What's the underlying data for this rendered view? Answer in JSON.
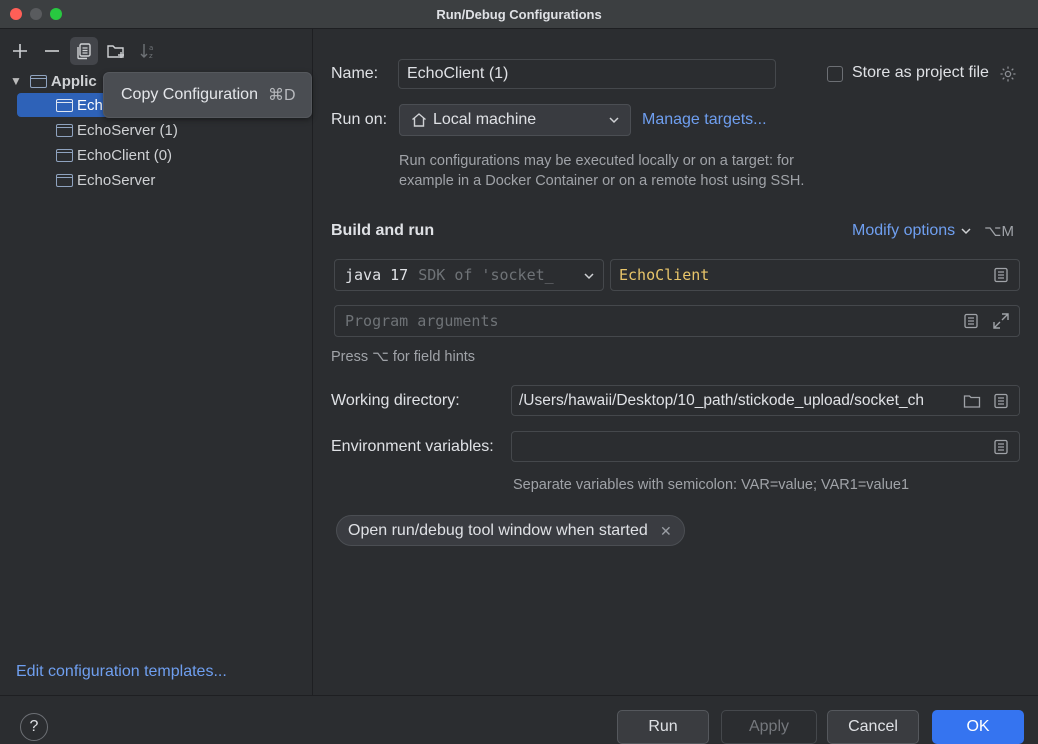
{
  "window": {
    "title": "Run/Debug Configurations"
  },
  "sidebar": {
    "tooltip": {
      "label": "Copy Configuration",
      "shortcut": "⌘D"
    },
    "tree": {
      "group_label": "Applic",
      "items": [
        {
          "label": "Echo",
          "selected": true
        },
        {
          "label": "EchoServer (1)"
        },
        {
          "label": "EchoClient (0)"
        },
        {
          "label": "EchoServer"
        }
      ]
    },
    "edit_templates": "Edit configuration templates..."
  },
  "form": {
    "name_label": "Name:",
    "name_value": "EchoClient (1)",
    "store_label": "Store as project file",
    "run_on_label": "Run on:",
    "run_on_value": "Local machine",
    "manage_targets": "Manage targets...",
    "run_hint_line1": "Run configurations may be executed locally or on a target: for",
    "run_hint_line2": "example in a Docker Container or on a remote host using SSH.",
    "build_run_title": "Build and run",
    "modify_options": "Modify options",
    "modify_shortcut": "⌥M",
    "sdk_value": "java 17",
    "sdk_hint": "SDK of 'socket_",
    "main_class": "EchoClient",
    "program_args_placeholder": "Program arguments",
    "field_hints": "Press ⌥ for field hints",
    "working_dir_label": "Working directory:",
    "working_dir_value": "/Users/hawaii/Desktop/10_path/stickode_upload/socket_ch",
    "env_label": "Environment variables:",
    "env_hint": "Separate variables with semicolon: VAR=value; VAR1=value1",
    "chip_label": "Open run/debug tool window when started"
  },
  "buttons": {
    "help": "?",
    "run": "Run",
    "apply": "Apply",
    "cancel": "Cancel",
    "ok": "OK"
  },
  "colors": {
    "accent": "#3574f0",
    "link": "#6f9ff0",
    "selection": "#2e62b8",
    "main_class": "#e8c56a"
  }
}
